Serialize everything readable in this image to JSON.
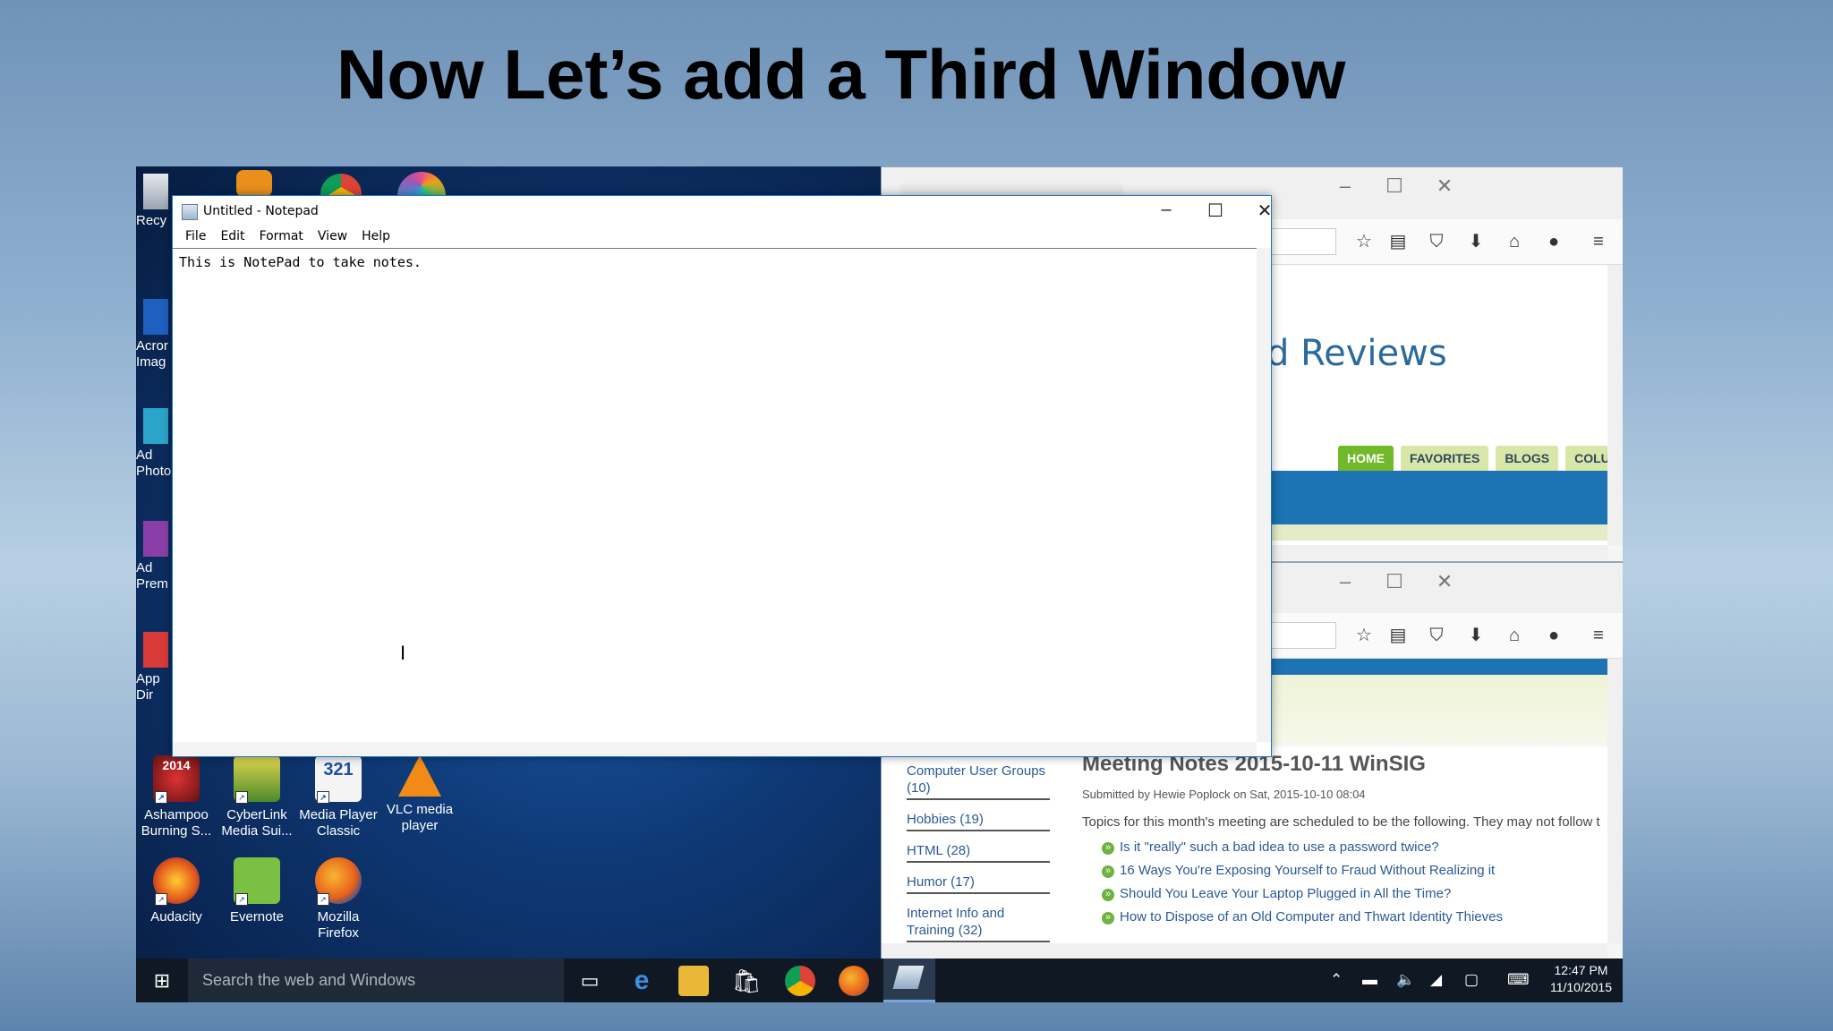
{
  "slide": {
    "title": "Now Let’s add a Third Window"
  },
  "desktop": {
    "left_labels": [
      "Recy",
      "Acror\nImag",
      "Ad\nPhoto",
      "Ad\nPrem",
      "App\nDir"
    ],
    "icons": [
      {
        "label": "Ashampoo Burning S...",
        "badge": "2014"
      },
      {
        "label": "CyberLink Media Sui..."
      },
      {
        "label": "Media Player Classic",
        "badge": "321"
      },
      {
        "label": "VLC media player"
      },
      {
        "label": "Audacity"
      },
      {
        "label": "Evernote"
      },
      {
        "label": "Mozilla Firefox"
      }
    ]
  },
  "notepad": {
    "title": "Untitled - Notepad",
    "menu": [
      "File",
      "Edit",
      "Format",
      "View",
      "Help"
    ],
    "content": "This is NotePad to take notes."
  },
  "browser_top": {
    "search_placeholder": "h",
    "heading": "d Reviews",
    "tabs": [
      "HOME",
      "FAVORITES",
      "BLOGS",
      "COLUMNS"
    ]
  },
  "browser_bottom": {
    "search_placeholder": "h",
    "categories": [
      "Computer User Groups (10)",
      "Hobbies (19)",
      "HTML (28)",
      "Humor (17)",
      "Internet Info and Training (32)"
    ],
    "post_title": "Meeting Notes 2015-10-11 WinSIG",
    "post_meta": "Submitted by Hewie Poplock on Sat, 2015-10-10 08:04",
    "post_intro": "Topics for this month's meeting are scheduled to be the following. They may not follow t",
    "post_links": [
      "Is it \"really\" such a bad idea to use a password twice?",
      "16 Ways You're Exposing Yourself to Fraud Without Realizing it",
      "Should You Leave Your Laptop Plugged in All the Time?",
      "How to Dispose of an Old Computer and Thwart Identity Thieves"
    ]
  },
  "taskbar": {
    "search_placeholder": "Search the web and Windows",
    "time": "12:47 PM",
    "date": "11/10/2015"
  },
  "colors": {
    "accent": "#1979ca",
    "site_blue": "#1d73b3",
    "site_green": "#72b92a"
  }
}
